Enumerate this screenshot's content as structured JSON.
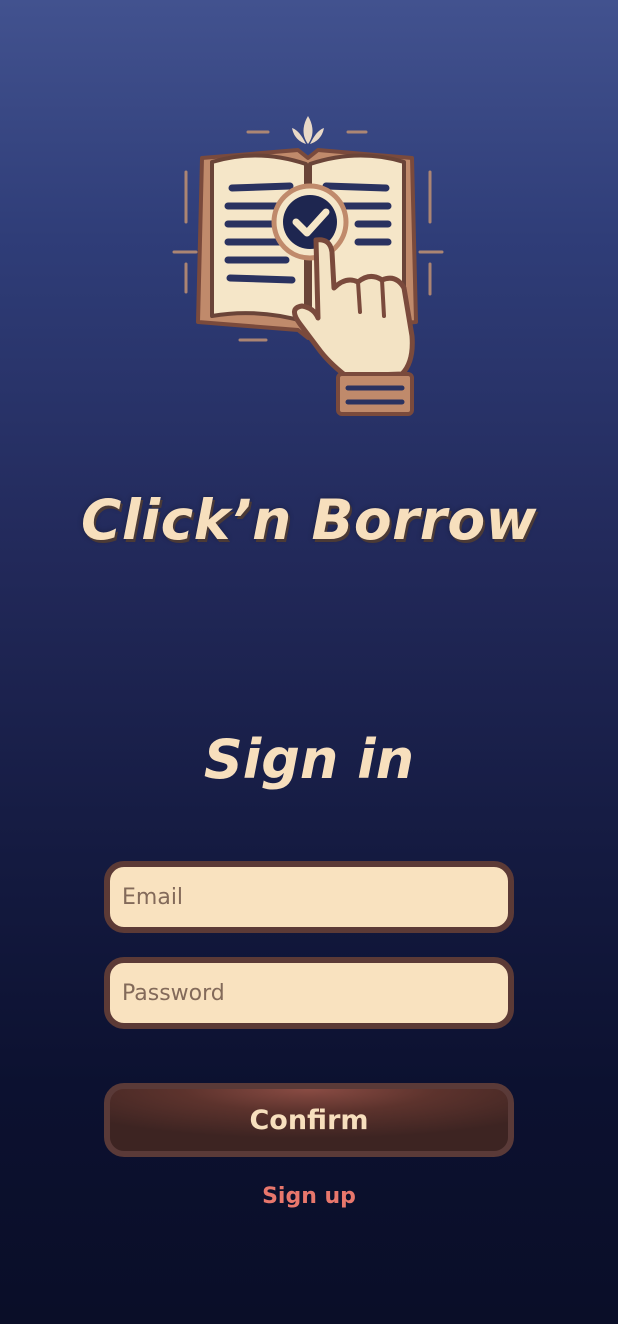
{
  "app": {
    "title": "Click’n Borrow",
    "logo_icon": "book-with-hand-check-icon"
  },
  "signin": {
    "heading": "Sign in",
    "email_placeholder": "Email",
    "password_placeholder": "Password",
    "confirm_label": "Confirm",
    "signup_label": "Sign up"
  },
  "colors": {
    "background_top": "#42528f",
    "background_bottom": "#0a0e28",
    "cream": "#f7dfbd",
    "input_fill": "#f9e2bf",
    "input_border": "#5c3a36",
    "button_fill": "#5d332d",
    "link": "#e8776c"
  }
}
